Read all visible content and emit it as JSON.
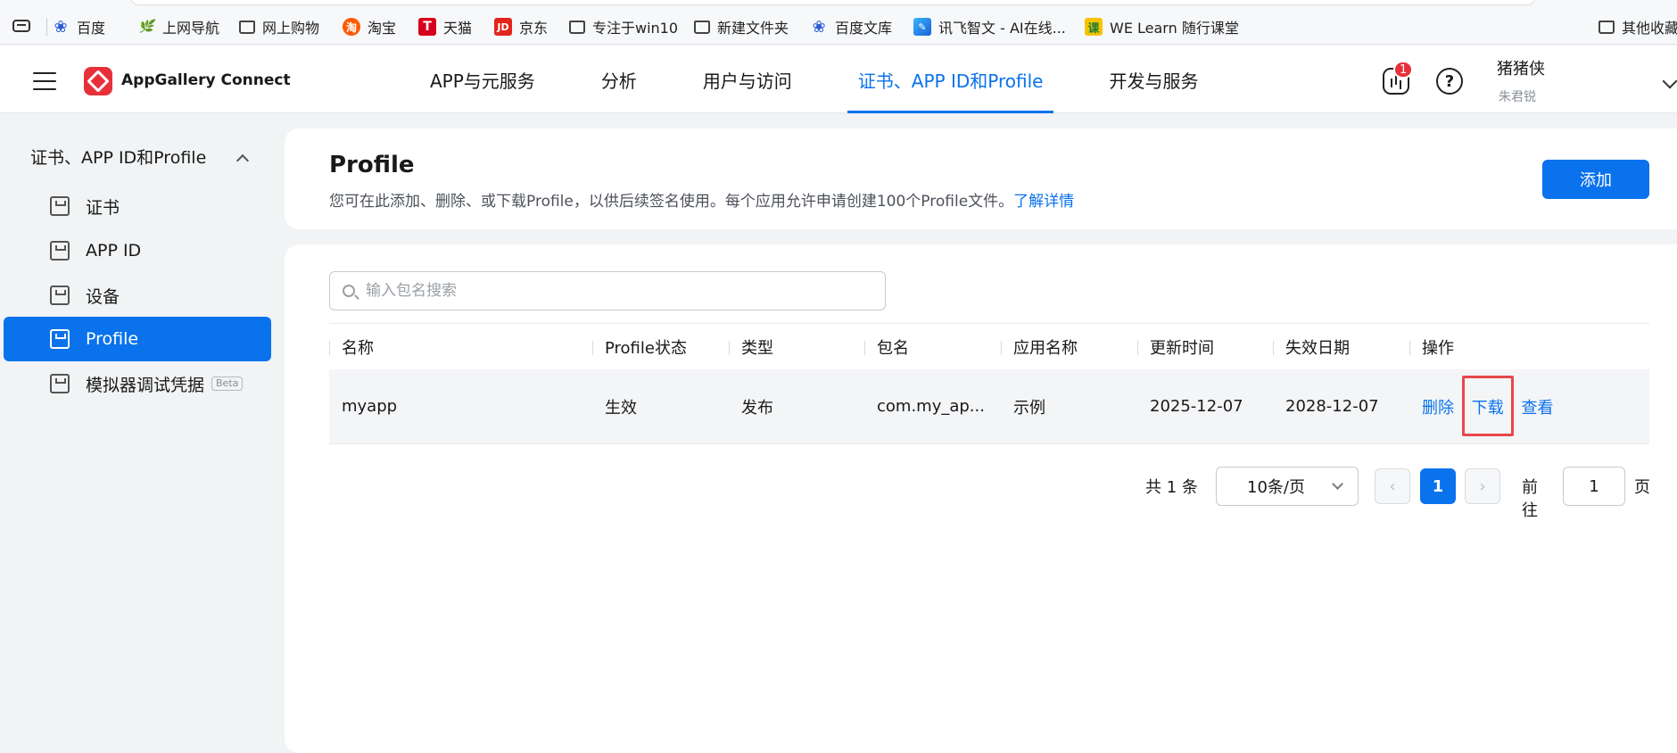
{
  "bookmarks": [
    {
      "label": "百度",
      "icon": "baidu-paw-icon"
    },
    {
      "label": "上网导航",
      "icon": "hao-icon"
    },
    {
      "label": "网上购物",
      "icon": "folder-icon"
    },
    {
      "label": "淘宝",
      "icon": "taobao-icon",
      "glyph": "淘"
    },
    {
      "label": "天猫",
      "icon": "tmall-icon",
      "glyph": "T"
    },
    {
      "label": "京东",
      "icon": "jd-icon",
      "glyph": "JD"
    },
    {
      "label": "专注于win10",
      "icon": "folder-icon"
    },
    {
      "label": "新建文件夹",
      "icon": "folder-icon"
    },
    {
      "label": "百度文库",
      "icon": "baidu-paw-icon"
    },
    {
      "label": "讯飞智文 - AI在线...",
      "icon": "xunfei-icon"
    },
    {
      "label": "WE Learn 随行课堂",
      "icon": "welearn-icon",
      "glyph": "课"
    },
    {
      "label": "其他收藏",
      "icon": "folder-icon"
    }
  ],
  "header": {
    "brand": "AppGallery Connect",
    "nav": [
      {
        "label": "APP与元服务",
        "active": false
      },
      {
        "label": "分析",
        "active": false
      },
      {
        "label": "用户与访问",
        "active": false
      },
      {
        "label": "证书、APP ID和Profile",
        "active": true
      },
      {
        "label": "开发与服务",
        "active": false
      }
    ],
    "notification_count": "1",
    "help_glyph": "?",
    "user_name": "猪猪侠",
    "user_sub": "朱君锐"
  },
  "sidebar": {
    "group_title": "证书、APP ID和Profile",
    "items": [
      {
        "label": "证书",
        "active": false
      },
      {
        "label": "APP ID",
        "active": false
      },
      {
        "label": "设备",
        "active": false
      },
      {
        "label": "Profile",
        "active": true
      },
      {
        "label": "模拟器调试凭据",
        "active": false,
        "badge": "Beta"
      }
    ]
  },
  "page": {
    "title": "Profile",
    "description": "您可在此添加、删除、或下载Profile，以供后续签名使用。每个应用允许申请创建100个Profile文件。",
    "learn_more": "了解详情",
    "add_label": "添加",
    "search_placeholder": "输入包名搜索"
  },
  "table": {
    "columns": [
      "名称",
      "Profile状态",
      "类型",
      "包名",
      "应用名称",
      "更新时间",
      "失效日期",
      "操作"
    ],
    "rows": [
      {
        "name": "myapp",
        "status": "生效",
        "type": "发布",
        "package": "com.my_ap...",
        "app_name": "示例",
        "updated": "2025-12-07",
        "expires": "2028-12-07",
        "actions": [
          "删除",
          "下载",
          "查看"
        ]
      }
    ]
  },
  "pagination": {
    "total": "共 1 条",
    "page_size": "10条/页",
    "prev_glyph": "‹",
    "next_glyph": "›",
    "current_page": "1",
    "goto_label": "前往",
    "goto_value": "1",
    "goto_suffix": "页"
  },
  "colors": {
    "accent": "#0a72ed",
    "brand_red": "#e8303a",
    "highlight_box": "#e8474a"
  }
}
